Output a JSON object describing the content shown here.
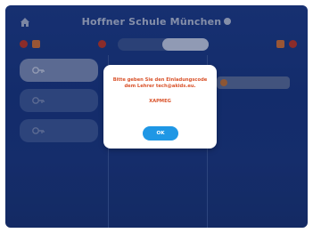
{
  "header": {
    "title": "Hoffner Schule München",
    "home_icon": "home-icon",
    "settings_icon": "gear-icon"
  },
  "tabs": [
    {
      "label": "",
      "active": false
    },
    {
      "label": "",
      "active": true
    }
  ],
  "students": [
    {
      "name": "",
      "selected": true
    },
    {
      "name": "",
      "selected": false
    },
    {
      "name": "",
      "selected": false
    }
  ],
  "entry": {
    "text": ""
  },
  "dialog": {
    "message": "Bitte geben Sie den Einladungscode dem Lehrer tech@akids.eu.",
    "code": "XAPMEG",
    "ok_label": "OK"
  },
  "colors": {
    "background": "#1f3f8e",
    "accent_orange": "#d9532b",
    "button_blue": "#1f97e5",
    "danger_red": "#c0392b"
  }
}
